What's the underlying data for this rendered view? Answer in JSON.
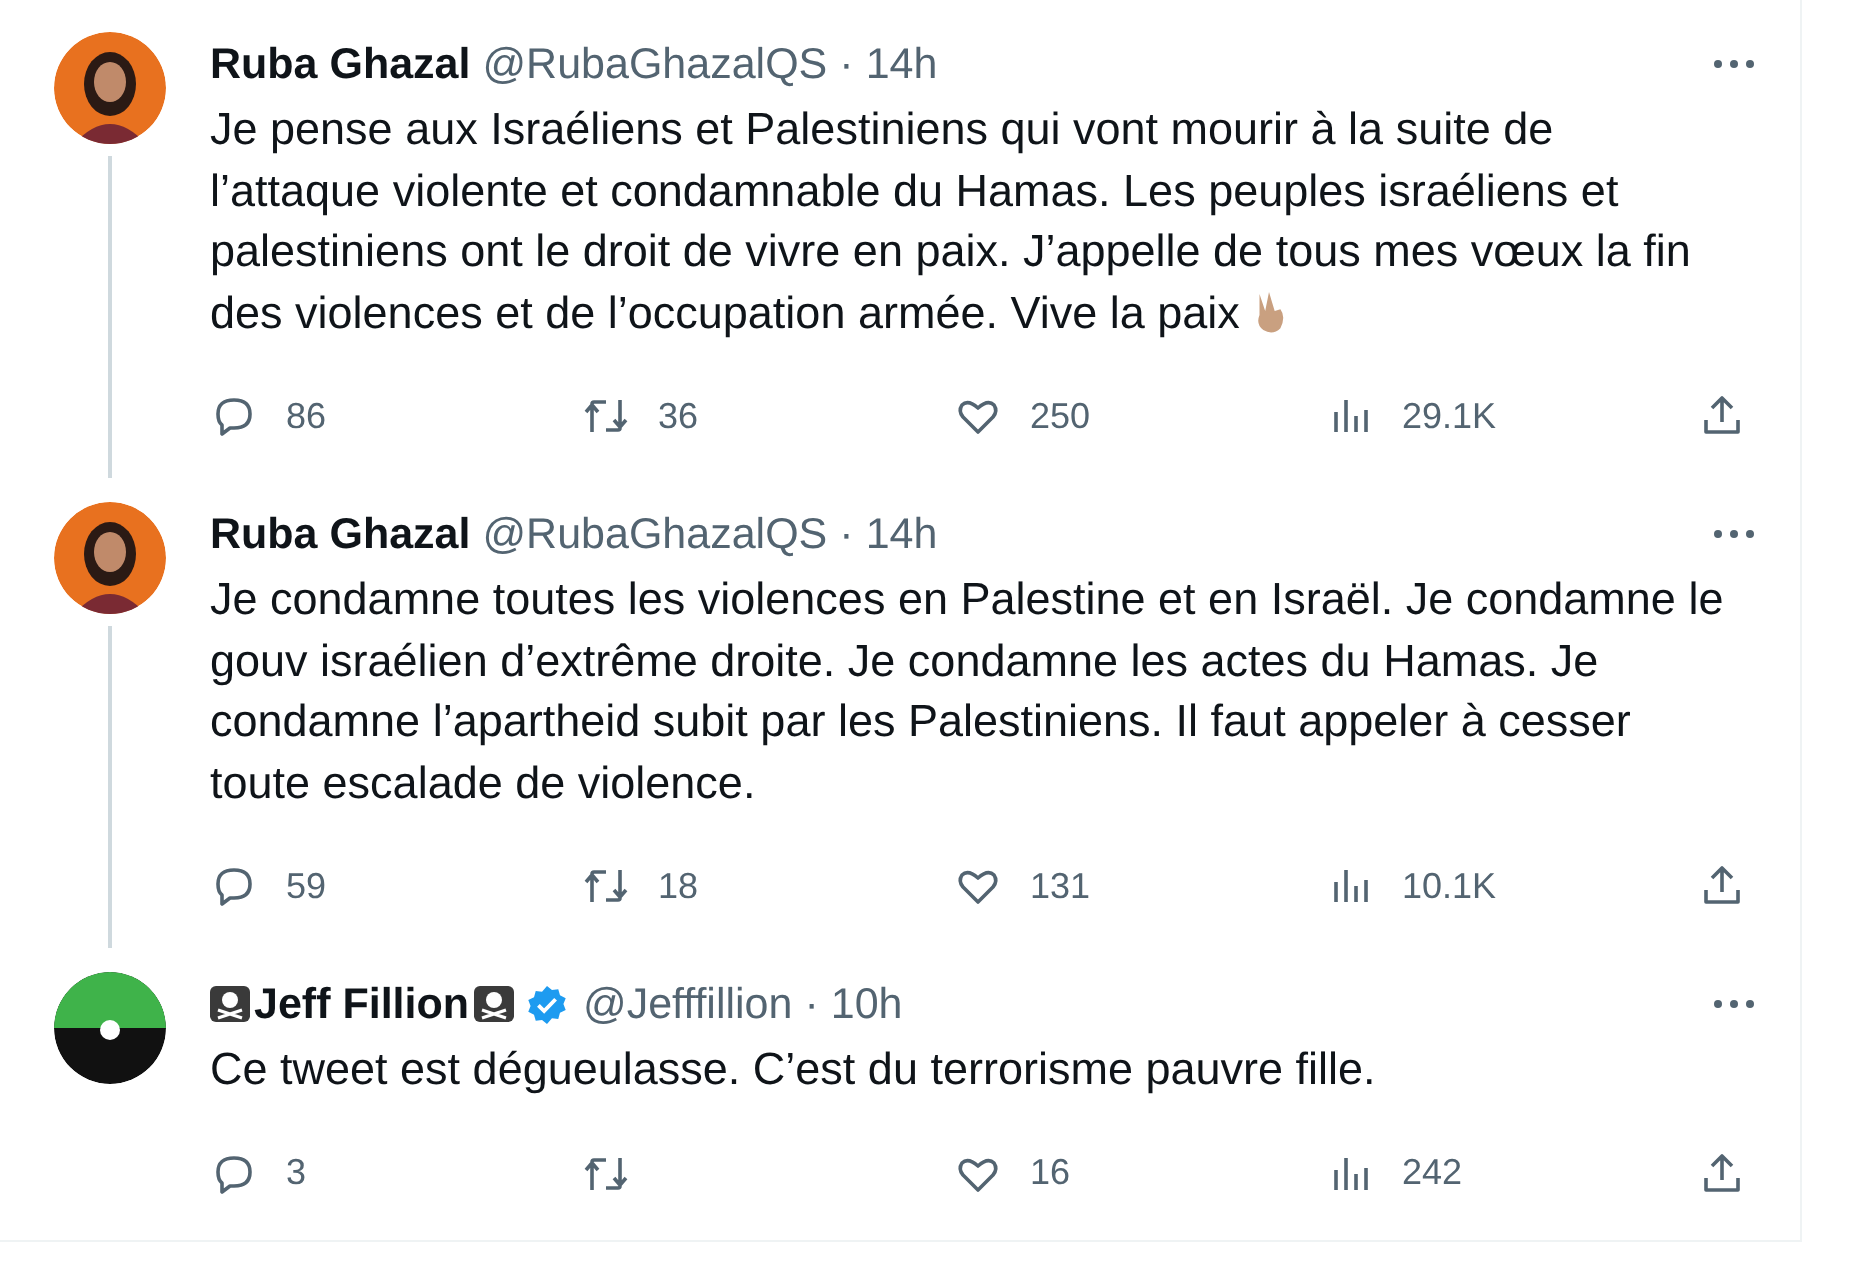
{
  "tweets": [
    {
      "name": "Ruba Ghazal",
      "skulls": false,
      "verified": false,
      "handle": "@RubaGhazalQS",
      "separator": "·",
      "time": "14h",
      "avatar": {
        "kind": "photo"
      },
      "text": "Je pense aux Israéliens et Palestiniens qui vont mourir à la suite de l’attaque violente et condamnable du Hamas. Les peuples israéliens et palestiniens ont le droit de vivre en paix. J’appelle de tous mes vœux la fin des violences et de l’occupation armée. Vive la paix",
      "peace_emoji": true,
      "thread_below": true,
      "stats": {
        "replies": "86",
        "retweets": "36",
        "likes": "250",
        "views": "29.1K"
      }
    },
    {
      "name": "Ruba Ghazal",
      "skulls": false,
      "verified": false,
      "handle": "@RubaGhazalQS",
      "separator": "·",
      "time": "14h",
      "avatar": {
        "kind": "photo"
      },
      "text": "Je condamne toutes les violences en Palestine et en Israël. Je condamne le gouv israélien d’extrême droite. Je condamne les actes du Hamas. Je condamne l’apartheid subit par les Palestiniens. Il faut appeler à cesser toute escalade de violence.",
      "peace_emoji": false,
      "thread_below": true,
      "stats": {
        "replies": "59",
        "retweets": "18",
        "likes": "131",
        "views": "10.1K"
      }
    },
    {
      "name": "Jeff Fillion",
      "skulls": true,
      "verified": true,
      "handle": "@Jefffillion",
      "separator": "·",
      "time": "10h",
      "avatar": {
        "kind": "logo"
      },
      "text": "Ce tweet est dégueulasse. C’est du terrorisme pauvre fille.",
      "peace_emoji": false,
      "thread_below": false,
      "stats": {
        "replies": "3",
        "likes": "16",
        "views": "242"
      }
    }
  ]
}
